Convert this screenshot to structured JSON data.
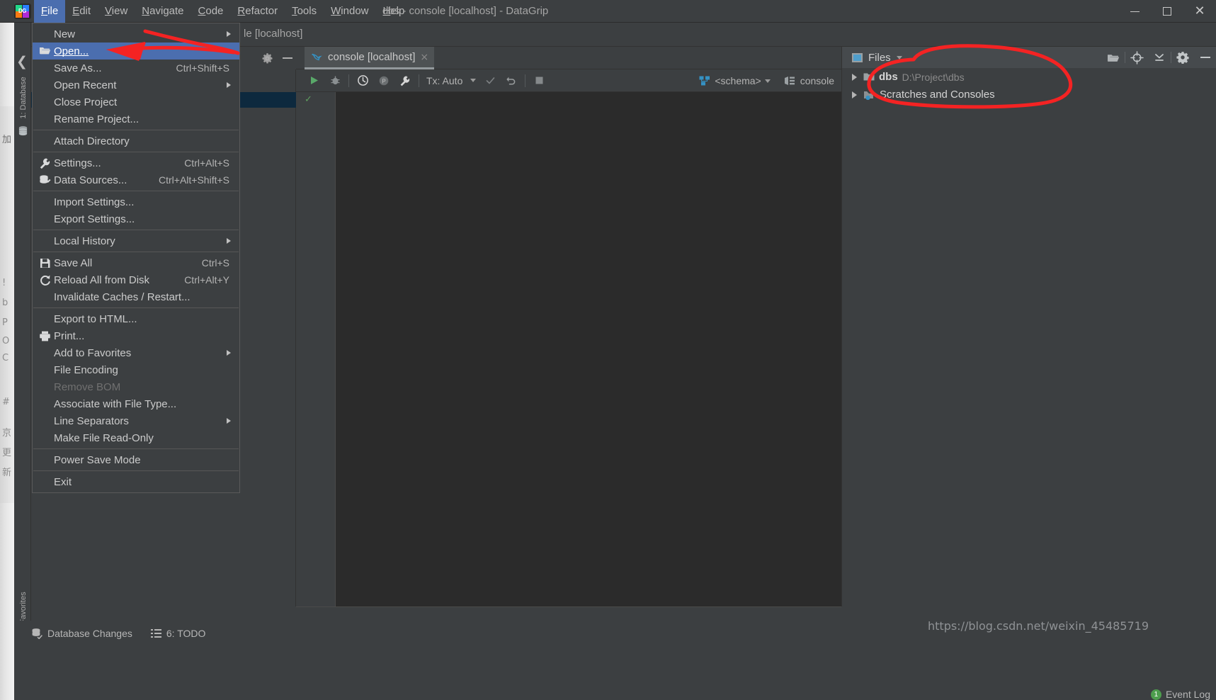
{
  "window": {
    "title": "dbs - console [localhost] - DataGrip",
    "logo_text": "DG",
    "controls": {
      "minimize": "minimize-icon",
      "maximize": "maximize-icon",
      "close": "close-icon"
    }
  },
  "menubar": {
    "items": [
      {
        "label": "File",
        "mnemonic": "F",
        "active": true
      },
      {
        "label": "Edit",
        "mnemonic": "E",
        "active": false
      },
      {
        "label": "View",
        "mnemonic": "V",
        "active": false
      },
      {
        "label": "Navigate",
        "mnemonic": "N",
        "active": false
      },
      {
        "label": "Code",
        "mnemonic": "C",
        "active": false
      },
      {
        "label": "Refactor",
        "mnemonic": "R",
        "active": false
      },
      {
        "label": "Tools",
        "mnemonic": "T",
        "active": false
      },
      {
        "label": "Window",
        "mnemonic": "W",
        "active": false
      },
      {
        "label": "Help",
        "mnemonic": "H",
        "active": false
      }
    ]
  },
  "file_menu": {
    "groups": [
      [
        {
          "label": "New",
          "shortcut": "",
          "icon": "",
          "submenu": true,
          "selected": false,
          "disabled": false
        },
        {
          "label": "Open...",
          "shortcut": "",
          "icon": "open-folder-icon",
          "submenu": false,
          "selected": true,
          "disabled": false
        },
        {
          "label": "Save As...",
          "shortcut": "Ctrl+Shift+S",
          "icon": "",
          "submenu": false,
          "selected": false,
          "disabled": false
        },
        {
          "label": "Open Recent",
          "shortcut": "",
          "icon": "",
          "submenu": true,
          "selected": false,
          "disabled": false
        },
        {
          "label": "Close Project",
          "shortcut": "",
          "icon": "",
          "submenu": false,
          "selected": false,
          "disabled": false
        },
        {
          "label": "Rename Project...",
          "shortcut": "",
          "icon": "",
          "submenu": false,
          "selected": false,
          "disabled": false
        }
      ],
      [
        {
          "label": "Attach Directory",
          "shortcut": "",
          "icon": "",
          "submenu": false,
          "selected": false,
          "disabled": false
        }
      ],
      [
        {
          "label": "Settings...",
          "shortcut": "Ctrl+Alt+S",
          "icon": "wrench-icon",
          "submenu": false,
          "selected": false,
          "disabled": false
        },
        {
          "label": "Data Sources...",
          "shortcut": "Ctrl+Alt+Shift+S",
          "icon": "data-sources-icon",
          "submenu": false,
          "selected": false,
          "disabled": false
        }
      ],
      [
        {
          "label": "Import Settings...",
          "shortcut": "",
          "icon": "",
          "submenu": false,
          "selected": false,
          "disabled": false
        },
        {
          "label": "Export Settings...",
          "shortcut": "",
          "icon": "",
          "submenu": false,
          "selected": false,
          "disabled": false
        }
      ],
      [
        {
          "label": "Local History",
          "shortcut": "",
          "icon": "",
          "submenu": true,
          "selected": false,
          "disabled": false
        }
      ],
      [
        {
          "label": "Save All",
          "shortcut": "Ctrl+S",
          "icon": "save-icon",
          "submenu": false,
          "selected": false,
          "disabled": false
        },
        {
          "label": "Reload All from Disk",
          "shortcut": "Ctrl+Alt+Y",
          "icon": "reload-icon",
          "submenu": false,
          "selected": false,
          "disabled": false
        },
        {
          "label": "Invalidate Caches / Restart...",
          "shortcut": "",
          "icon": "",
          "submenu": false,
          "selected": false,
          "disabled": false
        }
      ],
      [
        {
          "label": "Export to HTML...",
          "shortcut": "",
          "icon": "",
          "submenu": false,
          "selected": false,
          "disabled": false
        },
        {
          "label": "Print...",
          "shortcut": "",
          "icon": "printer-icon",
          "submenu": false,
          "selected": false,
          "disabled": false
        },
        {
          "label": "Add to Favorites",
          "shortcut": "",
          "icon": "",
          "submenu": true,
          "selected": false,
          "disabled": false
        },
        {
          "label": "File Encoding",
          "shortcut": "",
          "icon": "",
          "submenu": false,
          "selected": false,
          "disabled": false
        },
        {
          "label": "Remove BOM",
          "shortcut": "",
          "icon": "",
          "submenu": false,
          "selected": false,
          "disabled": true
        },
        {
          "label": "Associate with File Type...",
          "shortcut": "",
          "icon": "",
          "submenu": false,
          "selected": false,
          "disabled": false
        },
        {
          "label": "Line Separators",
          "shortcut": "",
          "icon": "",
          "submenu": true,
          "selected": false,
          "disabled": false
        },
        {
          "label": "Make File Read-Only",
          "shortcut": "",
          "icon": "",
          "submenu": false,
          "selected": false,
          "disabled": false
        }
      ],
      [
        {
          "label": "Power Save Mode",
          "shortcut": "",
          "icon": "",
          "submenu": false,
          "selected": false,
          "disabled": false
        }
      ],
      [
        {
          "label": "Exit",
          "shortcut": "",
          "icon": "",
          "submenu": false,
          "selected": false,
          "disabled": false
        }
      ]
    ]
  },
  "editor": {
    "partial_title": "le [localhost]",
    "tab": {
      "label": "console [localhost]",
      "close": "×",
      "icon": "dolphin-icon"
    },
    "toolbar": {
      "run": "run-icon",
      "debug": "debug-icon",
      "history": "history-icon",
      "profile": "profile-icon",
      "wrench": "wrench-icon",
      "tx_label": "Tx: Auto",
      "commit": "commit-check-icon",
      "rollback": "rollback-icon",
      "stop": "stop-icon",
      "schema_label": "<schema>",
      "schema_icon": "schema-icon",
      "session_label": "console",
      "session_icon": "session-icon"
    }
  },
  "files_panel": {
    "title": "Files",
    "title_icon": "files-window-icon",
    "dropdown_icon": "chevron-down-icon",
    "actions": [
      {
        "name": "open-folder-icon"
      },
      {
        "name": "scroll-from-source-icon"
      },
      {
        "name": "collapse-all-icon"
      },
      {
        "name": "gear-icon"
      },
      {
        "name": "hide-icon"
      }
    ],
    "tree": [
      {
        "label": "dbs",
        "sub": "D:\\Project\\dbs",
        "icon": "folder-icon",
        "expandable": true,
        "bold": true
      },
      {
        "label": "Scratches and Consoles",
        "sub": "",
        "icon": "scratches-icon",
        "expandable": true,
        "bold": false
      }
    ]
  },
  "left_tool_strip": {
    "database_label": "1: Database",
    "database_icon": "database-icon",
    "favorites_label": "Favorites",
    "favorites_icon": "star-icon",
    "back_icon": "back-arrow-icon",
    "folder_icon": "folder-icon",
    "ghost_glyphs": [
      "!",
      "b",
      "P",
      "O",
      "C",
      "#",
      "京",
      "更",
      "新"
    ],
    "behind_text": "加"
  },
  "statusbar": {
    "items": [
      {
        "label": "Database Changes",
        "icon": "db-changes-icon"
      },
      {
        "label": "6: TODO",
        "icon": "todo-icon"
      }
    ],
    "event_log": {
      "label": "Event Log",
      "count": "1"
    }
  },
  "watermark": "https://blog.csdn.net/weixin_45485719",
  "colors": {
    "accent": "#4b6eaf",
    "annotation": "#fb2222",
    "background": "#3c3f41",
    "editor_bg": "#2b2b2b",
    "panel_header": "#464a4d"
  }
}
